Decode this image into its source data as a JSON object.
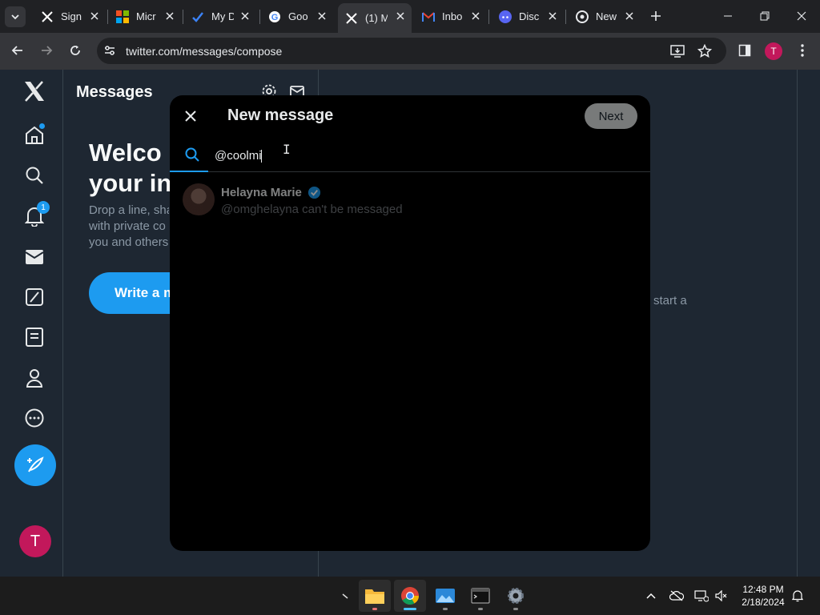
{
  "browser": {
    "tabs": [
      {
        "title": "Sign",
        "favicon": "x-logo"
      },
      {
        "title": "Micr",
        "favicon": "microsoft-logo"
      },
      {
        "title": "My D",
        "favicon": "todo-check"
      },
      {
        "title": "Goo",
        "favicon": "google-logo"
      },
      {
        "title": "(1) M",
        "favicon": "x-logo",
        "active": true
      },
      {
        "title": "Inbo",
        "favicon": "gmail-logo"
      },
      {
        "title": "Disc",
        "favicon": "discord-logo"
      },
      {
        "title": "New",
        "favicon": "chrome-logo"
      }
    ],
    "url": "twitter.com/messages/compose",
    "profile_initial": "T"
  },
  "x": {
    "nav": {
      "notifications_badge": "1",
      "profile_initial": "T"
    },
    "messages": {
      "title": "Messages",
      "welcome_title_line1": "Welco",
      "welcome_title_line2": "your in",
      "welcome_sub_line1": "Drop a line, sha",
      "welcome_sub_line2": "with private co",
      "welcome_sub_line3": "you and others",
      "write_button": "Write a m"
    },
    "right_pane_text": "start a",
    "modal": {
      "title": "New message",
      "next_label": "Next",
      "search_value": "@coolmi",
      "results": [
        {
          "name": "Helayna Marie",
          "subtitle": "@omghelayna can't be messaged",
          "verified": true
        }
      ]
    }
  },
  "taskbar": {
    "time": "12:48 PM",
    "date": "2/18/2024",
    "apps": [
      "file-explorer",
      "chrome",
      "photos",
      "terminal",
      "settings"
    ]
  },
  "colors": {
    "accent": "#1d9bf0",
    "page_bg": "#1e2732",
    "modal_bg": "#000000",
    "profile": "#c2185b"
  }
}
